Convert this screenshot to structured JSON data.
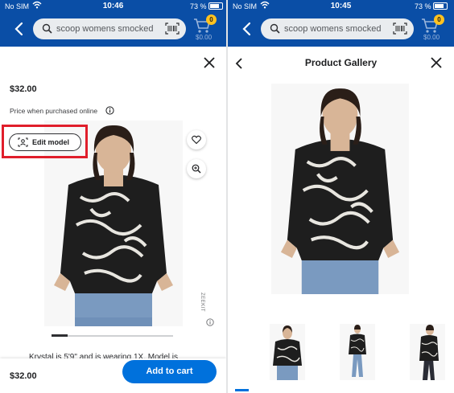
{
  "colors": {
    "header_blue": "#0a4ea6",
    "accent_blue": "#0071dc",
    "highlight_red": "#e01e2b",
    "badge_yellow": "#ffc220"
  },
  "left": {
    "status": {
      "carrier": "No SIM",
      "time": "10:46",
      "battery": "73 %"
    },
    "search": {
      "query": "scoop womens smocked",
      "search_icon": "search-icon",
      "barcode_icon": "barcode-icon"
    },
    "cart": {
      "count": "0",
      "amount": "$0.00"
    },
    "price": "$32.00",
    "price_note": "Price when purchased online",
    "edit_model_label": "Edit model",
    "zeekit_label": "ZEEKIT",
    "carousel_position": 0.13,
    "description_partial": "Krystal is 5'9\" and is wearing 1X. Model is",
    "bottom_price": "$32.00",
    "add_to_cart_label": "Add to cart"
  },
  "right": {
    "status": {
      "carrier": "No SIM",
      "time": "10:45",
      "battery": "73 %"
    },
    "search": {
      "query": "scoop womens smocked"
    },
    "cart": {
      "count": "0",
      "amount": "$0.00"
    },
    "gallery_title": "Product Gallery"
  }
}
